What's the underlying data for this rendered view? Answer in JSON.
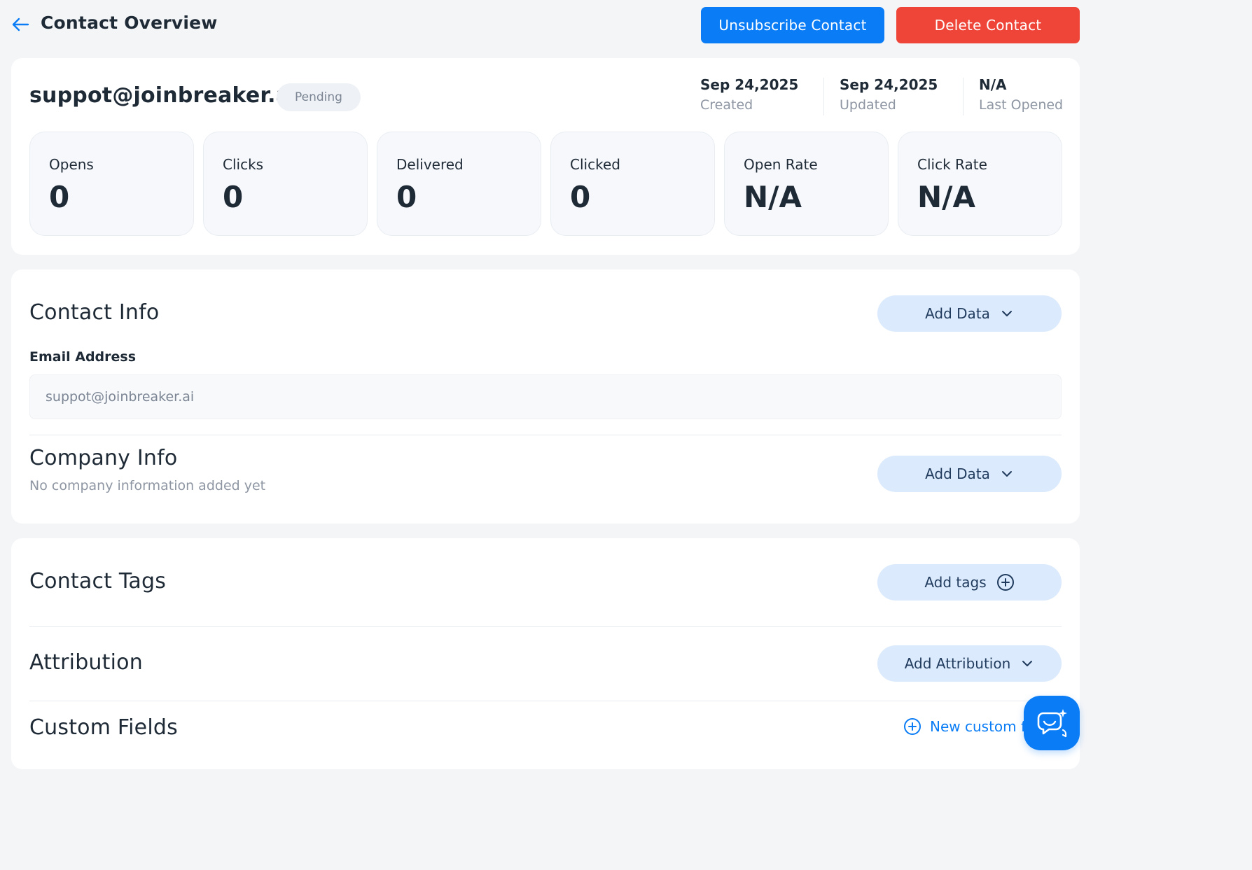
{
  "header": {
    "title": "Contact Overview",
    "unsubscribe_label": "Unsubscribe Contact",
    "delete_label": "Delete Contact"
  },
  "summary": {
    "email": "suppot@joinbreaker.ai",
    "status": "Pending",
    "meta": [
      {
        "value": "Sep 24,2025",
        "label": "Created"
      },
      {
        "value": "Sep 24,2025",
        "label": "Updated"
      },
      {
        "value": "N/A",
        "label": "Last Opened"
      }
    ],
    "stats": [
      {
        "label": "Opens",
        "value": "0"
      },
      {
        "label": "Clicks",
        "value": "0"
      },
      {
        "label": "Delivered",
        "value": "0"
      },
      {
        "label": "Clicked",
        "value": "0"
      },
      {
        "label": "Open Rate",
        "value": "N/A"
      },
      {
        "label": "Click Rate",
        "value": "N/A"
      }
    ]
  },
  "contact_info": {
    "title": "Contact Info",
    "add_data_label": "Add Data",
    "email_label": "Email Address",
    "email_value": "suppot@joinbreaker.ai"
  },
  "company_info": {
    "title": "Company Info",
    "empty_text": "No company information added yet",
    "add_data_label": "Add Data"
  },
  "tags": {
    "title": "Contact Tags",
    "add_label": "Add tags"
  },
  "attribution": {
    "title": "Attribution",
    "add_label": "Add Attribution"
  },
  "custom_fields": {
    "title": "Custom Fields",
    "new_label": "New custom f"
  },
  "colors": {
    "primary": "#0a7cf5",
    "danger": "#ef4438",
    "pill_bg": "#dbeafc",
    "background": "#f4f5f7"
  },
  "icons": {
    "back": "arrow-left-icon",
    "dropdown": "chevron-down-icon",
    "add": "plus-circle-icon",
    "chat": "chat-sparkle-icon"
  }
}
